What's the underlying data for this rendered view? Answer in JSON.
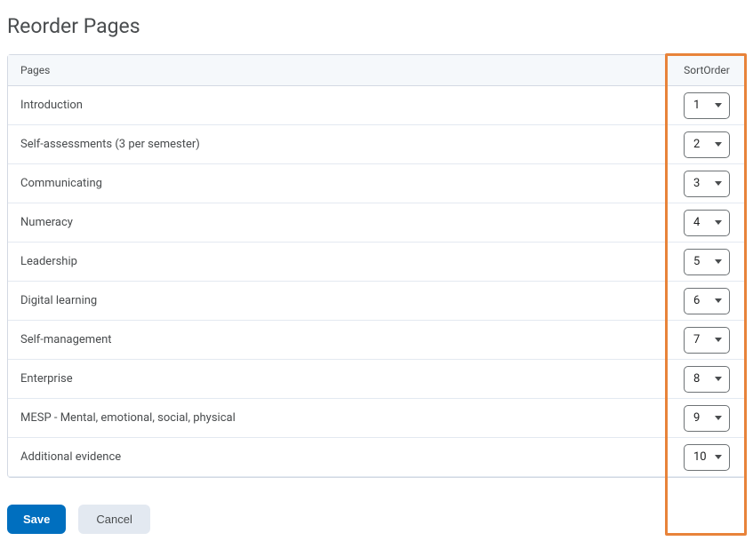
{
  "page_title": "Reorder Pages",
  "table": {
    "pages_header": "Pages",
    "sort_header": "SortOrder",
    "rows": [
      {
        "label": "Introduction",
        "order": "1"
      },
      {
        "label": "Self-assessments (3 per semester)",
        "order": "2"
      },
      {
        "label": "Communicating",
        "order": "3"
      },
      {
        "label": "Numeracy",
        "order": "4"
      },
      {
        "label": "Leadership",
        "order": "5"
      },
      {
        "label": "Digital learning",
        "order": "6"
      },
      {
        "label": "Self-management",
        "order": "7"
      },
      {
        "label": "Enterprise",
        "order": "8"
      },
      {
        "label": "MESP - Mental, emotional, social, physical",
        "order": "9"
      },
      {
        "label": "Additional evidence",
        "order": "10"
      }
    ]
  },
  "buttons": {
    "save": "Save",
    "cancel": "Cancel"
  },
  "colors": {
    "highlight": "#e8833a",
    "primary": "#006fbf"
  }
}
